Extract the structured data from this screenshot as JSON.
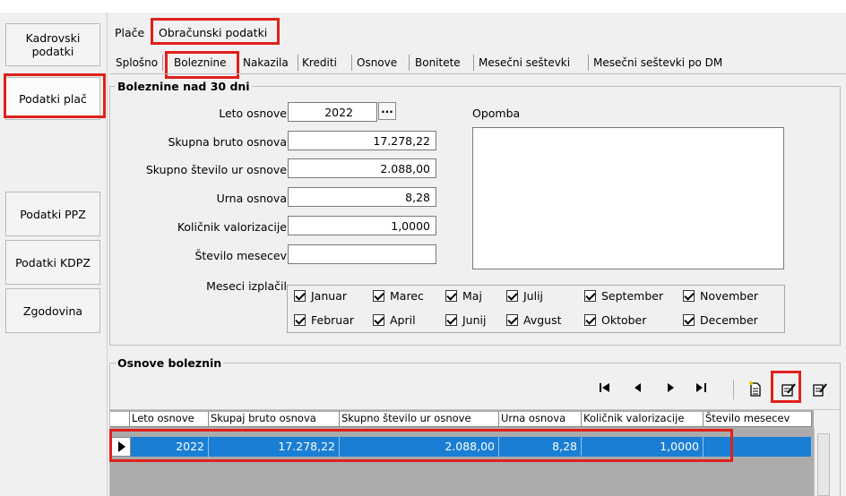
{
  "sidebar": {
    "items": [
      {
        "label": "Kadrovski podatki"
      },
      {
        "label": "Podatki plač"
      },
      {
        "label": "Podatki PPZ"
      },
      {
        "label": "Podatki KDPZ"
      },
      {
        "label": "Zgodovina"
      }
    ]
  },
  "top_tabs": [
    "Plače",
    "Obračunski podatki"
  ],
  "sub_tabs": [
    "Splošno",
    "Boleznine",
    "Nakazila",
    "Krediti",
    "Osnove",
    "Bonitete",
    "Mesečni seštevki",
    "Mesečni seštevki po DM"
  ],
  "group1": {
    "title": "Boleznine nad 30 dni",
    "leto_osnove_label": "Leto osnove",
    "leto_osnove_value": "2022",
    "ellipsis": "...",
    "skupna_bruto_label": "Skupna bruto osnova",
    "skupna_bruto_value": "17.278,22",
    "skupno_ur_label": "Skupno število ur osnove",
    "skupno_ur_value": "2.088,00",
    "urna_label": "Urna osnova",
    "urna_value": "8,28",
    "kolicnik_label": "Količnik valorizacije",
    "kolicnik_value": "1,0000",
    "st_mesecev_label": "Število mesecev",
    "st_mesecev_value": "",
    "opomba_label": "Opomba",
    "meseci_label": "Meseci izplačil",
    "months": [
      "Januar",
      "Marec",
      "Maj",
      "Julij",
      "September",
      "November",
      "Februar",
      "April",
      "Junij",
      "Avgust",
      "Oktober",
      "December"
    ]
  },
  "group2": {
    "title": "Osnove boleznin",
    "columns": [
      "Leto osnove",
      "Skupaj bruto osnova",
      "Skupno število ur osnove",
      "Urna osnova",
      "Količnik valorizacije",
      "Število mesecev"
    ],
    "rows": [
      [
        "2022",
        "17.278,22",
        "2.088,00",
        "8,28",
        "1,0000",
        ""
      ]
    ]
  },
  "colors": {
    "accent_red": "#e0201c",
    "selection_blue": "#1a7fd4"
  }
}
